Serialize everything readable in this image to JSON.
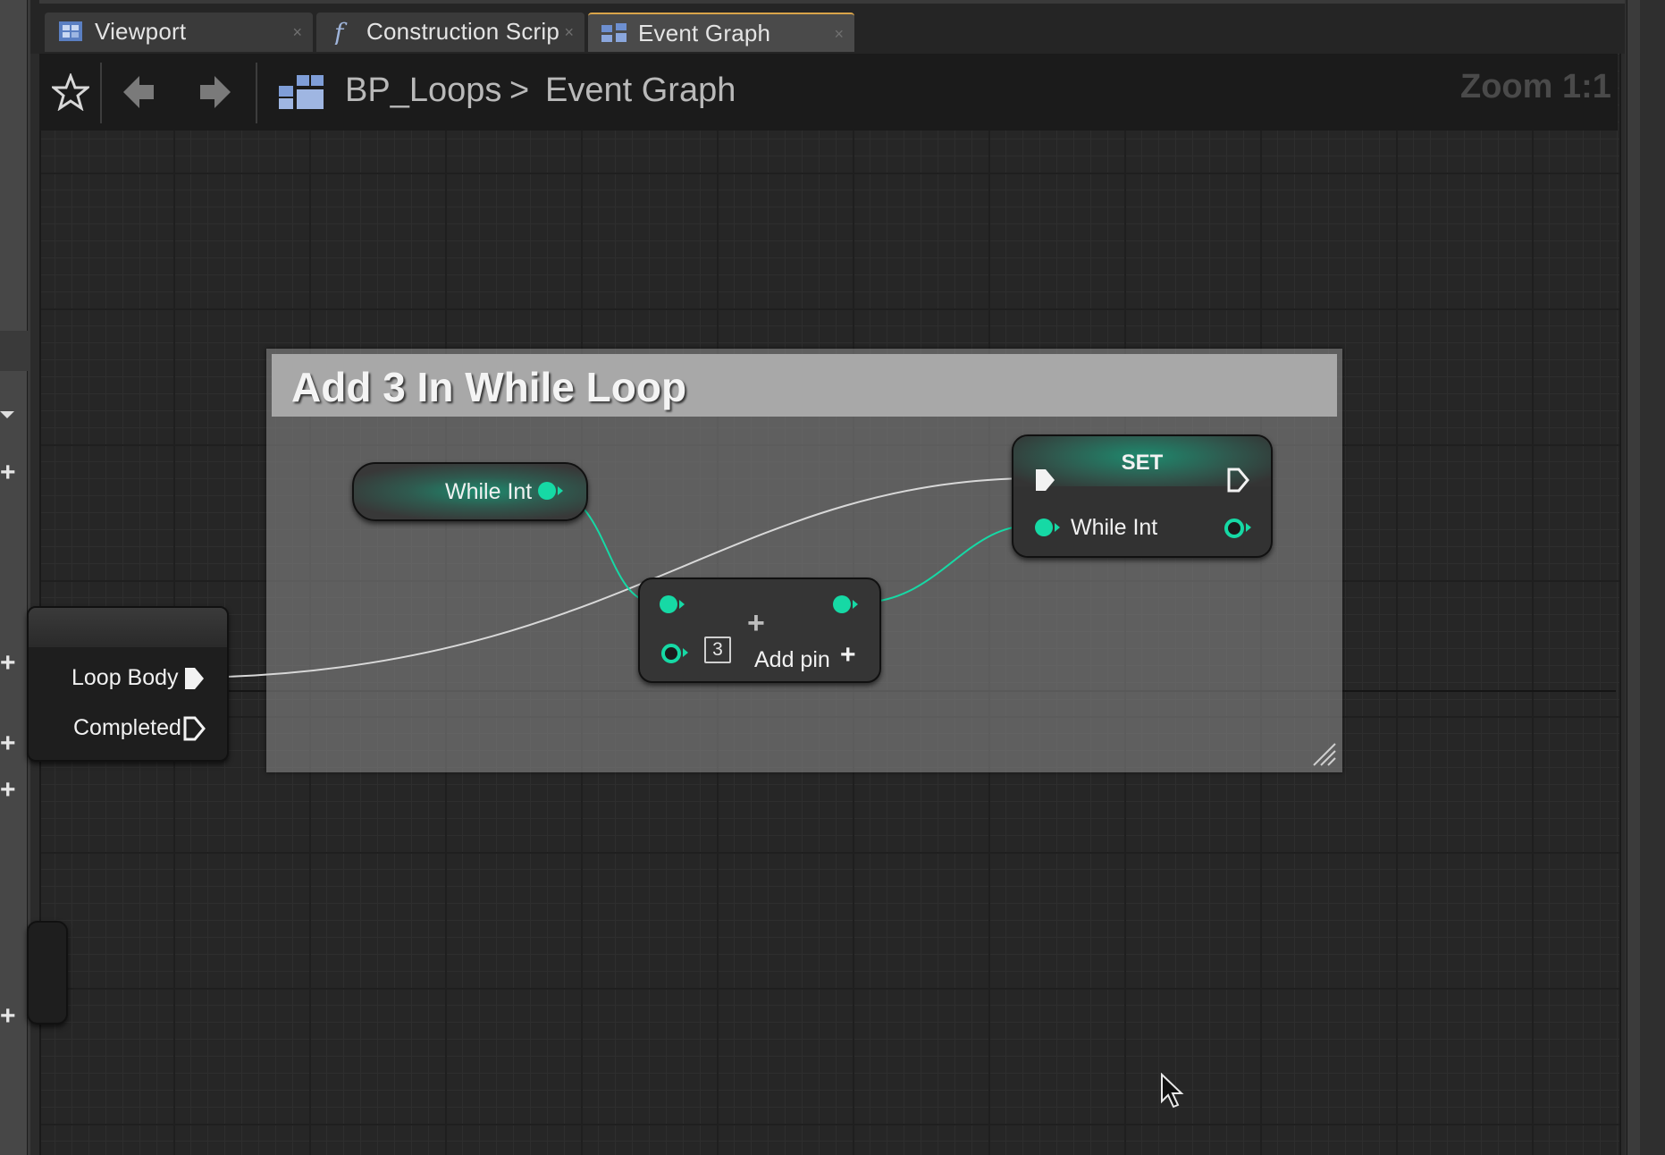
{
  "tabs": [
    {
      "label": "Viewport",
      "icon": "viewport-icon",
      "active": false
    },
    {
      "label": "Construction Scrip",
      "icon": "function-icon",
      "active": false
    },
    {
      "label": "Event Graph",
      "icon": "event-graph-icon",
      "active": true
    }
  ],
  "tab_close_glyph": "×",
  "breadcrumb": {
    "blueprint": "BP_Loops",
    "separator": ">",
    "graph": "Event Graph"
  },
  "zoom_label": "Zoom 1:1",
  "comment": {
    "title": "Add 3 In While Loop"
  },
  "get_node": {
    "label": "While Int"
  },
  "set_node": {
    "title": "SET",
    "pin_label": "While Int"
  },
  "add_node": {
    "literal_value": "3",
    "add_pin_label": "Add pin",
    "plus_glyph": "+"
  },
  "loop_node": {
    "loop_body_label": "Loop Body",
    "completed_label": "Completed"
  },
  "colors": {
    "pin_int": "#16d9a5",
    "accent_tab": "#d9a44a",
    "comment_header": "#a8a8a8"
  }
}
